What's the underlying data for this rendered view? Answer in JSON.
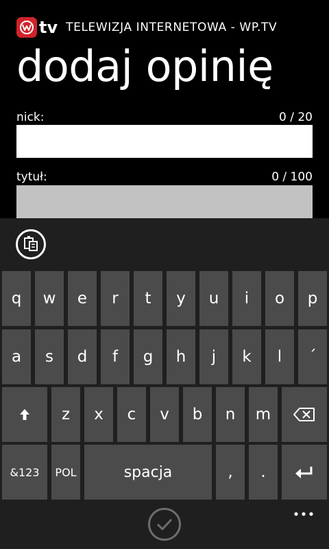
{
  "header": {
    "logo_text": "tv",
    "app_title": "TELEWIZJA INTERNETOWA - WP.TV",
    "brand_color": "#d0232a"
  },
  "page": {
    "title": "dodaj opinię"
  },
  "form": {
    "nick": {
      "label": "nick:",
      "counter": "0 / 20",
      "value": ""
    },
    "tytul": {
      "label": "tytuł:",
      "counter": "0 / 100",
      "value": ""
    }
  },
  "keyboard": {
    "row1": [
      "q",
      "w",
      "e",
      "r",
      "t",
      "y",
      "u",
      "i",
      "o",
      "p"
    ],
    "row2": [
      "a",
      "s",
      "d",
      "f",
      "g",
      "h",
      "j",
      "k",
      "l",
      "´"
    ],
    "row3": [
      "z",
      "x",
      "c",
      "v",
      "b",
      "n",
      "m"
    ],
    "symbols_key": "&123",
    "language_key": "POL",
    "space_key": "spacja",
    "comma_key": ",",
    "period_key": ".",
    "icons": {
      "clipboard": "clipboard-icon",
      "shift": "shift-arrow-icon",
      "backspace": "backspace-icon",
      "enter": "enter-icon",
      "confirm": "checkmark-icon",
      "more": "ellipsis-icon"
    }
  }
}
